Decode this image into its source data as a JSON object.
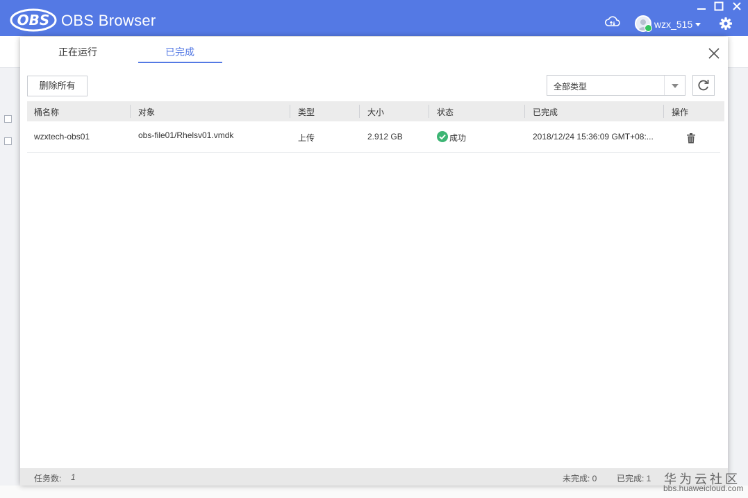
{
  "app": {
    "logo_text": "OBS",
    "name": "OBS Browser"
  },
  "user": {
    "name": "wzx_515"
  },
  "colors": {
    "brand": "#5479e4",
    "success": "#3db574",
    "header_bg": "#ececec",
    "status_bg": "#e8e8e8"
  },
  "dialog": {
    "tabs": [
      {
        "label": "正在运行",
        "active": false
      },
      {
        "label": "已完成",
        "active": true
      }
    ],
    "delete_all_label": "删除所有",
    "type_filter": {
      "selected": "全部类型"
    },
    "columns": [
      "桶名称",
      "对象",
      "类型",
      "大小",
      "状态",
      "已完成",
      "操作"
    ],
    "rows": [
      {
        "bucket": "wzxtech-obs01",
        "object": "obs-file01/Rhelsv01.vmdk",
        "type": "上传",
        "size": "2.912 GB",
        "status": "成功",
        "completed": "2018/12/24 15:36:09 GMT+08:..."
      }
    ],
    "footer": {
      "task_count_label": "任务数:",
      "task_count": "1",
      "incomplete_label": "未完成: 0",
      "complete_label": "已完成: 1"
    }
  },
  "watermark": {
    "line1": "华为云社区",
    "line2": "bbs.huaweicloud.com"
  }
}
